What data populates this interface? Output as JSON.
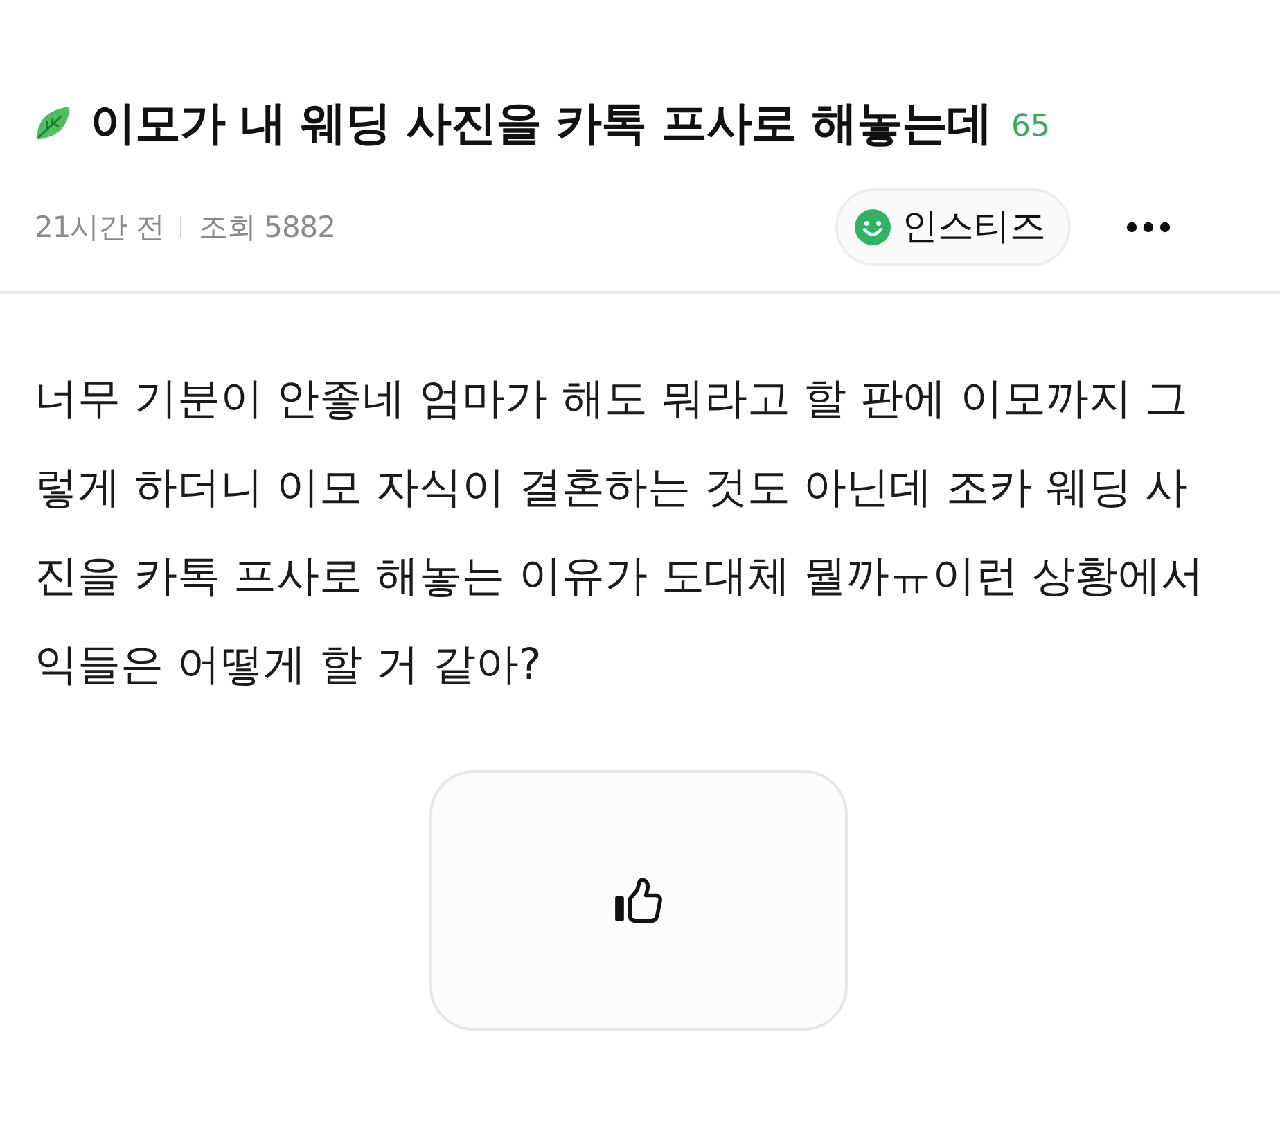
{
  "post": {
    "title": "이모가 내 웨딩 사진을 카톡 프사로 해놓는데",
    "comment_count": "65",
    "time": "21시간 전",
    "views": "조회 5882",
    "source": "인스티즈",
    "body": "너무 기분이 안좋네 엄마가 해도 뭐라고 할 판에 이모까지 그렇게 하더니 이모 자식이 결혼하는 것도 아닌데 조카 웨딩 사진을 카톡 프사로 해놓는 이유가 도대체 뭘까ㅠ이런 상황에서 익들은 어떻게 할 거 같아?"
  }
}
